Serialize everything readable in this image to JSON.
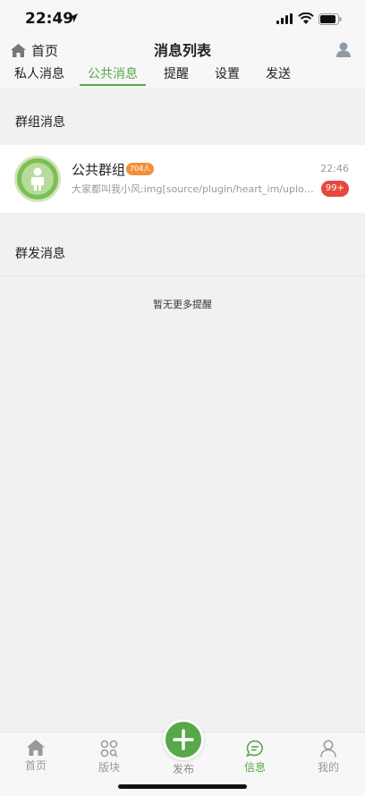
{
  "status_bar": {
    "time": "22:49"
  },
  "header": {
    "home_label": "首页",
    "title": "消息列表"
  },
  "tabs": [
    {
      "label": "私人消息",
      "active": false
    },
    {
      "label": "公共消息",
      "active": true
    },
    {
      "label": "提醒",
      "active": false
    },
    {
      "label": "设置",
      "active": false
    },
    {
      "label": "发送",
      "active": false
    }
  ],
  "sections": {
    "group_title": "群组消息",
    "broadcast_title": "群发消息"
  },
  "group": {
    "name": "公共群组",
    "member_count": "704人",
    "last_message": "大家都叫我小风:img[source/plugin/heart_im/uploadi...",
    "time": "22:46",
    "unread": "99+"
  },
  "empty_hint": "暂无更多提醒",
  "bottom_nav": {
    "items": [
      {
        "label": "首页",
        "icon": "home-icon"
      },
      {
        "label": "版块",
        "icon": "forum-icon"
      },
      {
        "label": "发布",
        "icon": "plus-icon"
      },
      {
        "label": "信息",
        "icon": "message-icon",
        "active": true
      },
      {
        "label": "我的",
        "icon": "person-icon"
      }
    ]
  },
  "colors": {
    "accent": "#5aa64a",
    "badge_orange": "#f0913a",
    "badge_red": "#e5483e"
  }
}
